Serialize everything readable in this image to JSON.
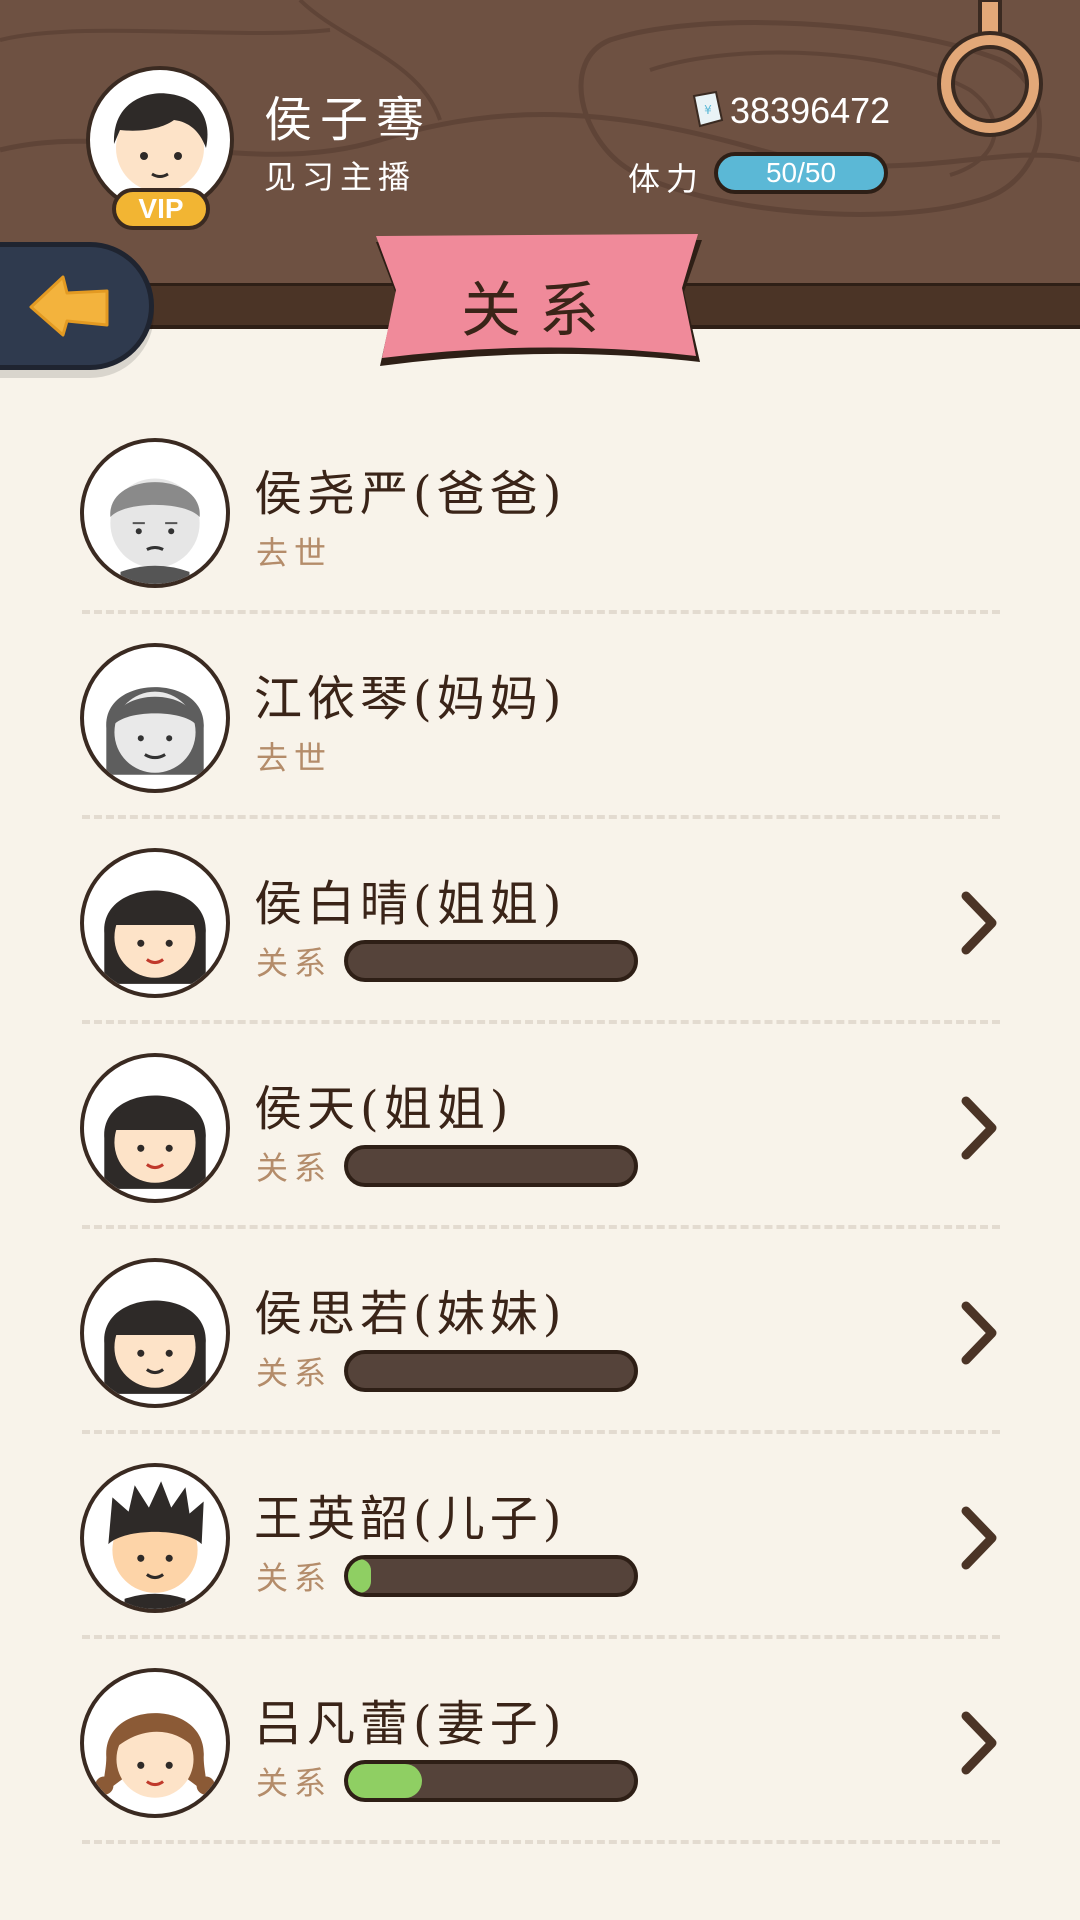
{
  "player": {
    "name": "侯子骞",
    "title": "见习主播",
    "vip_label": "VIP",
    "money": "38396472",
    "stamina_label": "体力",
    "stamina": "50/50"
  },
  "page": {
    "title": "关系"
  },
  "relations": [
    {
      "name": "侯尧严(爸爸)",
      "status": "去世",
      "avatar": "old-man-gray",
      "deceased": true
    },
    {
      "name": "江依琴(妈妈)",
      "status": "去世",
      "avatar": "old-woman-gray",
      "deceased": true
    },
    {
      "name": "侯白晴(姐姐)",
      "label": "关系",
      "avatar": "woman-black-hair",
      "relationship": 0.0
    },
    {
      "name": "侯天(姐姐)",
      "label": "关系",
      "avatar": "woman-black-hair",
      "relationship": 0.0
    },
    {
      "name": "侯思若(妹妹)",
      "label": "关系",
      "avatar": "girl-black-hair",
      "relationship": 0.0
    },
    {
      "name": "王英韶(儿子)",
      "label": "关系",
      "avatar": "boy-spiky-hair",
      "relationship": 0.08
    },
    {
      "name": "吕凡蕾(妻子)",
      "label": "关系",
      "avatar": "woman-brown-hair",
      "relationship": 0.26
    }
  ],
  "colors": {
    "wood": "#6e5142",
    "banner": "#f08a9a",
    "relationship_fill": "#8fcf63",
    "stamina": "#5bb8d6",
    "back_button": "#2f3a4e"
  }
}
